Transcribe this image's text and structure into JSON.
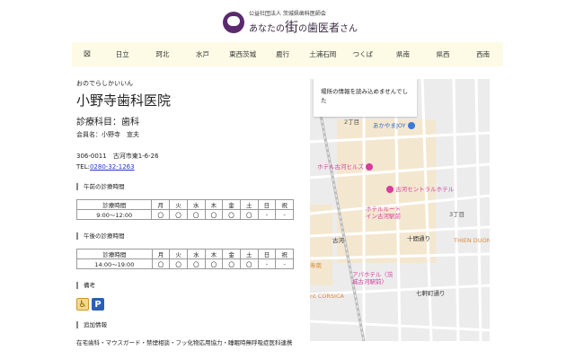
{
  "header": {
    "org": "公益社団法人 茨城県歯科医師会",
    "title_pre": "あなたの",
    "title_big": "街",
    "title_mid": "の",
    "title_big2": "歯医者",
    "title_post": "さん"
  },
  "nav": {
    "map_icon": "⊠",
    "items": [
      "日立",
      "珂北",
      "水戸",
      "東西茨城",
      "鹿行",
      "土浦石岡",
      "つくば",
      "県南",
      "県西",
      "西南"
    ]
  },
  "clinic": {
    "kana": "おのでらしかいいん",
    "name": "小野寺歯科医院",
    "department": "診療科目：歯科",
    "member": "会員名：小野寺　宣夫",
    "address": "306-0011　古河市東1-6-26",
    "tel_label": "TEL:",
    "tel": "0280-32-1263"
  },
  "morning": {
    "title": "午前の診療時間",
    "headers": [
      "診療時間",
      "月",
      "火",
      "水",
      "木",
      "金",
      "土",
      "日",
      "祝"
    ],
    "row": [
      "9:00〜12:00",
      "〇",
      "〇",
      "〇",
      "〇",
      "〇",
      "〇",
      "-",
      "-"
    ]
  },
  "afternoon": {
    "title": "午後の診療時間",
    "headers": [
      "診療時間",
      "月",
      "火",
      "水",
      "木",
      "金",
      "土",
      "日",
      "祝"
    ],
    "row": [
      "14:00〜19:00",
      "〇",
      "〇",
      "〇",
      "〇",
      "〇",
      "〇",
      "-",
      "-"
    ]
  },
  "remarks": {
    "title": "備考",
    "icons": [
      "wheelchair-icon",
      "parking-icon"
    ],
    "parking": "P",
    "wheelchair": "♿"
  },
  "extra": {
    "title": "追加情報",
    "text": "在宅歯科・マウスガード・禁煙相談・フッ化物応用協力・睡眠時無呼吸症医科連携"
  },
  "map": {
    "error": "場所の情報を読み込めませんでした",
    "labels": [
      "あかやまJOY",
      "ホテル古河ヒルズ",
      "古河セントラルホテル",
      "ホテルルートイン古河駅前",
      "古河",
      "十間通り",
      "THIEN DUON",
      "アパホテル〈茨城古河駅前〉",
      "七軒町通り",
      "nt CORSICA",
      "2丁目",
      "3丁目",
      "寿南"
    ]
  }
}
